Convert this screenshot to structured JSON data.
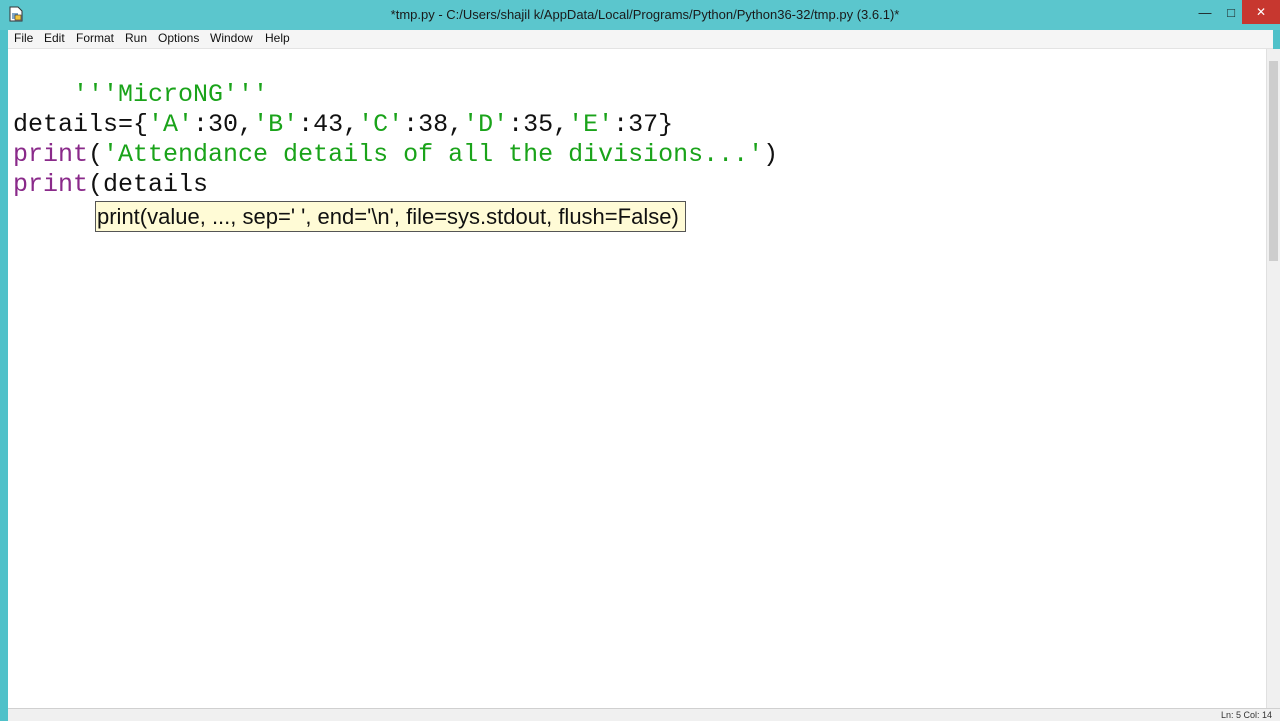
{
  "window": {
    "title": "*tmp.py - C:/Users/shajil k/AppData/Local/Programs/Python/Python36-32/tmp.py (3.6.1)*",
    "icons": {
      "app": "python-idle-icon",
      "minimize": "minimize-icon",
      "maximize": "maximize-icon",
      "close": "close-icon"
    }
  },
  "menu": {
    "items": [
      {
        "label": "File"
      },
      {
        "label": "Edit"
      },
      {
        "label": "Format"
      },
      {
        "label": "Run"
      },
      {
        "label": "Options"
      },
      {
        "label": "Window"
      },
      {
        "label": "Help"
      }
    ]
  },
  "editor": {
    "lines": [
      {
        "text": "'''MicroNG'''"
      },
      {
        "text": ""
      },
      {
        "parts": [
          "details={",
          "'A'",
          ":30,",
          "'B'",
          ":43,",
          "'C'",
          ":38,",
          "'D'",
          ":35,",
          "'E'",
          ":37}"
        ]
      },
      {
        "parts": [
          "print",
          "(",
          "'Attendance details of all the divisions...'",
          ")"
        ]
      },
      {
        "parts": [
          "print",
          "(details"
        ]
      }
    ],
    "calltip": "print(value, ..., sep=' ', end='\\n', file=sys.stdout, flush=False)"
  },
  "status": {
    "position": "Ln: 5   Col: 14"
  },
  "colors": {
    "titlebar": "#5bc6cd",
    "string": "#1aa31a",
    "builtin": "#8a2a8a",
    "calltip_bg": "#fffbd6"
  }
}
